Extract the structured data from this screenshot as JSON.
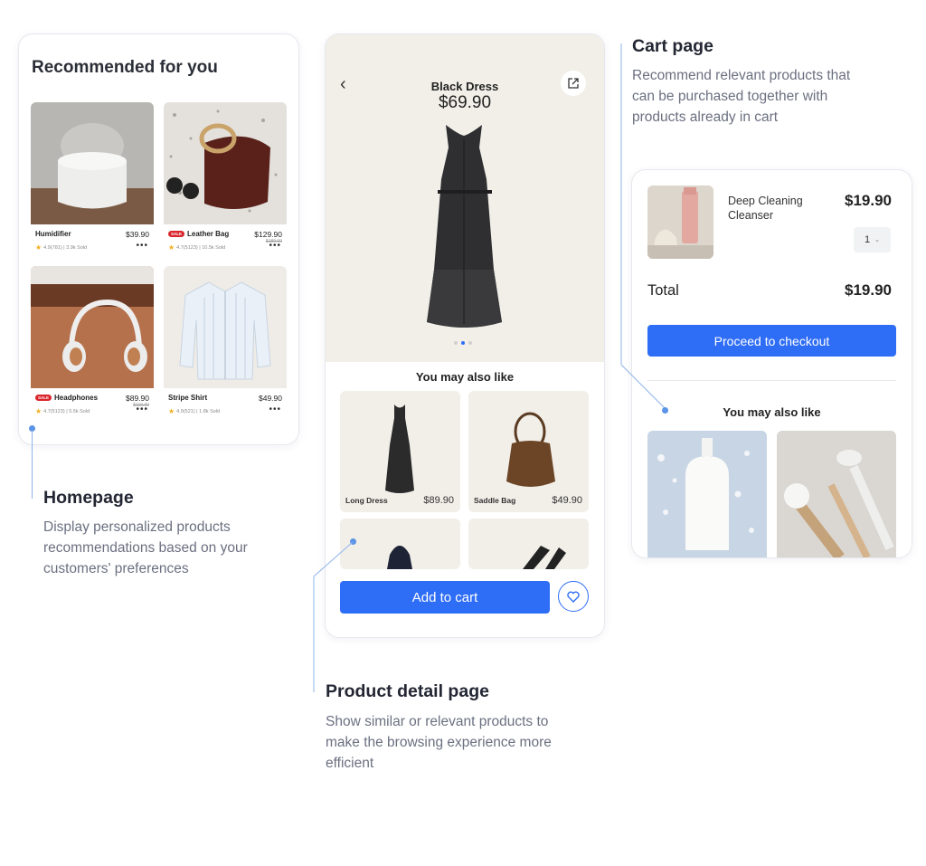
{
  "homepage_card": {
    "title": "Recommended for you",
    "products": [
      {
        "name": "Humidifier",
        "price": "$39.90",
        "old_price": "",
        "sale": false,
        "rating": "4.9(781) | 3.9k Sold"
      },
      {
        "name": "Leather Bag",
        "price": "$129.90",
        "old_price": "$189.00",
        "sale": true,
        "rating": "4.7(5123) | 10.5k Sold"
      },
      {
        "name": "Headphones",
        "price": "$89.90",
        "old_price": "$119.00",
        "sale": true,
        "rating": "4.7(5123) | 5.5k Sold"
      },
      {
        "name": "Stripe Shirt",
        "price": "$49.90",
        "old_price": "",
        "sale": false,
        "rating": "4.9(521) | 1.8k Sold"
      }
    ],
    "sale_label": "SALE",
    "more_label": "•••"
  },
  "product_detail_card": {
    "product_name": "Black Dress",
    "product_price": "$69.90",
    "back_icon": "chevron-left-icon",
    "share_icon": "share-icon",
    "carousel": {
      "count": 3,
      "active": 1
    },
    "section_title": "You may also like",
    "related": [
      {
        "name": "Long Dress",
        "price": "$89.90"
      },
      {
        "name": "Saddle Bag",
        "price": "$49.90"
      }
    ],
    "add_to_cart_label": "Add to cart",
    "heart_icon": "heart-icon"
  },
  "cart_card": {
    "item_name": "Deep Cleaning Cleanser",
    "item_price": "$19.90",
    "quantity": "1",
    "total_label": "Total",
    "total_value": "$19.90",
    "checkout_label": "Proceed to checkout",
    "section_title": "You may also like"
  },
  "annotations": {
    "homepage": {
      "title": "Homepage",
      "desc": "Display personalized products recommendations based on your customers' preferences"
    },
    "product_detail": {
      "title": "Product detail page",
      "desc": "Show similar or relevant products to make the browsing experience more efficient"
    },
    "cart": {
      "title": "Cart page",
      "desc": "Recommend relevant products that can be purchased together with products already in cart"
    }
  },
  "colors": {
    "accent": "#2e6df5",
    "sale": "#d9262c",
    "star": "#f2b01e",
    "annotation_line": "#8fb4ea"
  }
}
